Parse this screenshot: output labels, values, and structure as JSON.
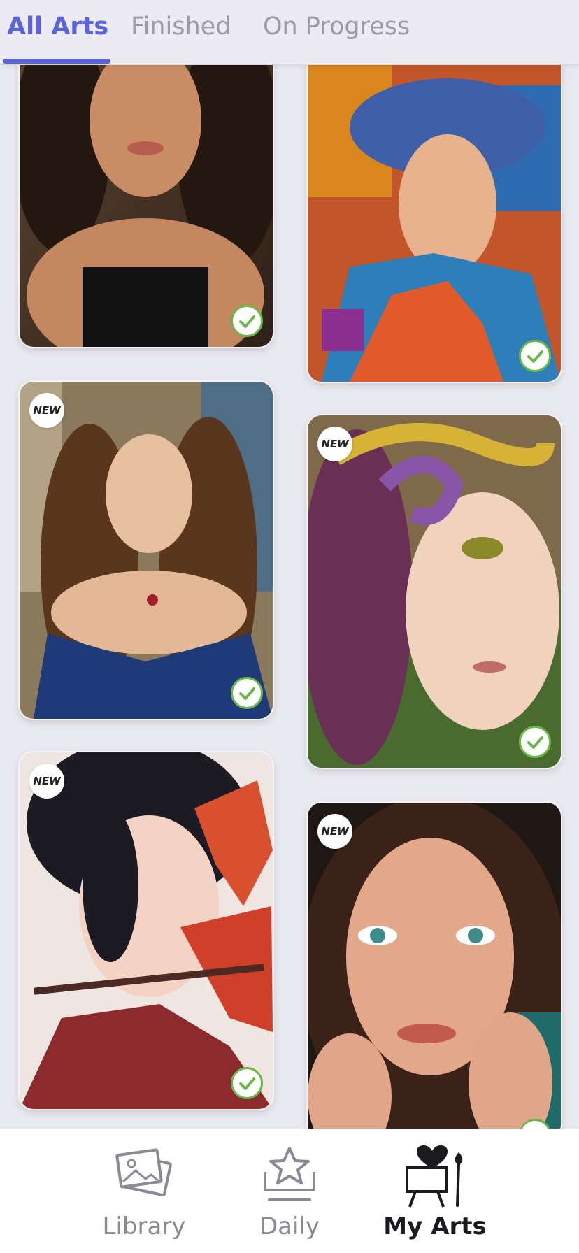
{
  "tabs": [
    {
      "label": "All Arts",
      "active": true
    },
    {
      "label": "Finished",
      "active": false
    },
    {
      "label": "On Progress",
      "active": false
    }
  ],
  "artworks": [
    {
      "subject": "curly-haired woman in black tank top",
      "badge": "",
      "completed": true
    },
    {
      "subject": "woman in colorful hat, impasto painting",
      "badge": "",
      "completed": true
    },
    {
      "subject": "woman with long curly hair in blue dress",
      "badge": "NEW",
      "completed": true
    },
    {
      "subject": "woman with snake headdress, watercolor",
      "badge": "NEW",
      "completed": true
    },
    {
      "subject": "girl with bow and red leaves",
      "badge": "NEW",
      "completed": true
    },
    {
      "subject": "woman with freckles, hands on cheeks",
      "badge": "NEW",
      "completed": true
    }
  ],
  "nav": [
    {
      "label": "Library",
      "icon": "photos-stack-icon",
      "active": false
    },
    {
      "label": "Daily",
      "icon": "star-tray-icon",
      "active": false
    },
    {
      "label": "My Arts",
      "icon": "easel-heart-icon",
      "active": true
    }
  ],
  "colors": {
    "accent": "#5a63dc",
    "check": "#69b84a",
    "background": "#e9e9f0"
  }
}
